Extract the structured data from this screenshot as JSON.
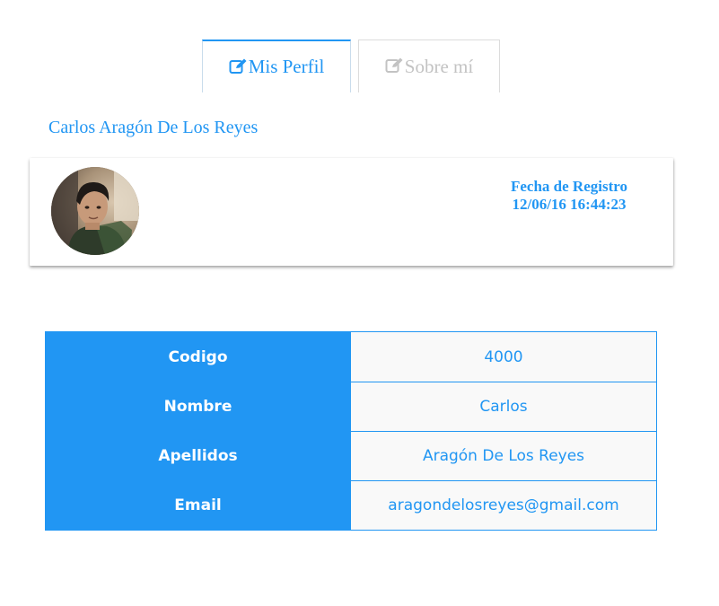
{
  "tabs": [
    {
      "label": "Mis Perfil",
      "icon": "edit-icon",
      "active": true
    },
    {
      "label": "Sobre mí",
      "icon": "edit-icon",
      "active": false
    }
  ],
  "profile": {
    "full_name": "Carlos Aragón De Los Reyes",
    "avatar_icon": "user-photo",
    "registration_label": "Fecha de Registro",
    "registration_date": "12/06/16 16:44:23"
  },
  "details": [
    {
      "label": "Codigo",
      "value": "4000"
    },
    {
      "label": "Nombre",
      "value": "Carlos"
    },
    {
      "label": "Apellidos",
      "value": "Aragón De Los Reyes"
    },
    {
      "label": "Email",
      "value": "aragondelosreyes@gmail.com"
    }
  ],
  "colors": {
    "accent": "#2196f3",
    "inactive_tab_text": "#c3c3c3",
    "cell_background": "#f9f9f9"
  }
}
